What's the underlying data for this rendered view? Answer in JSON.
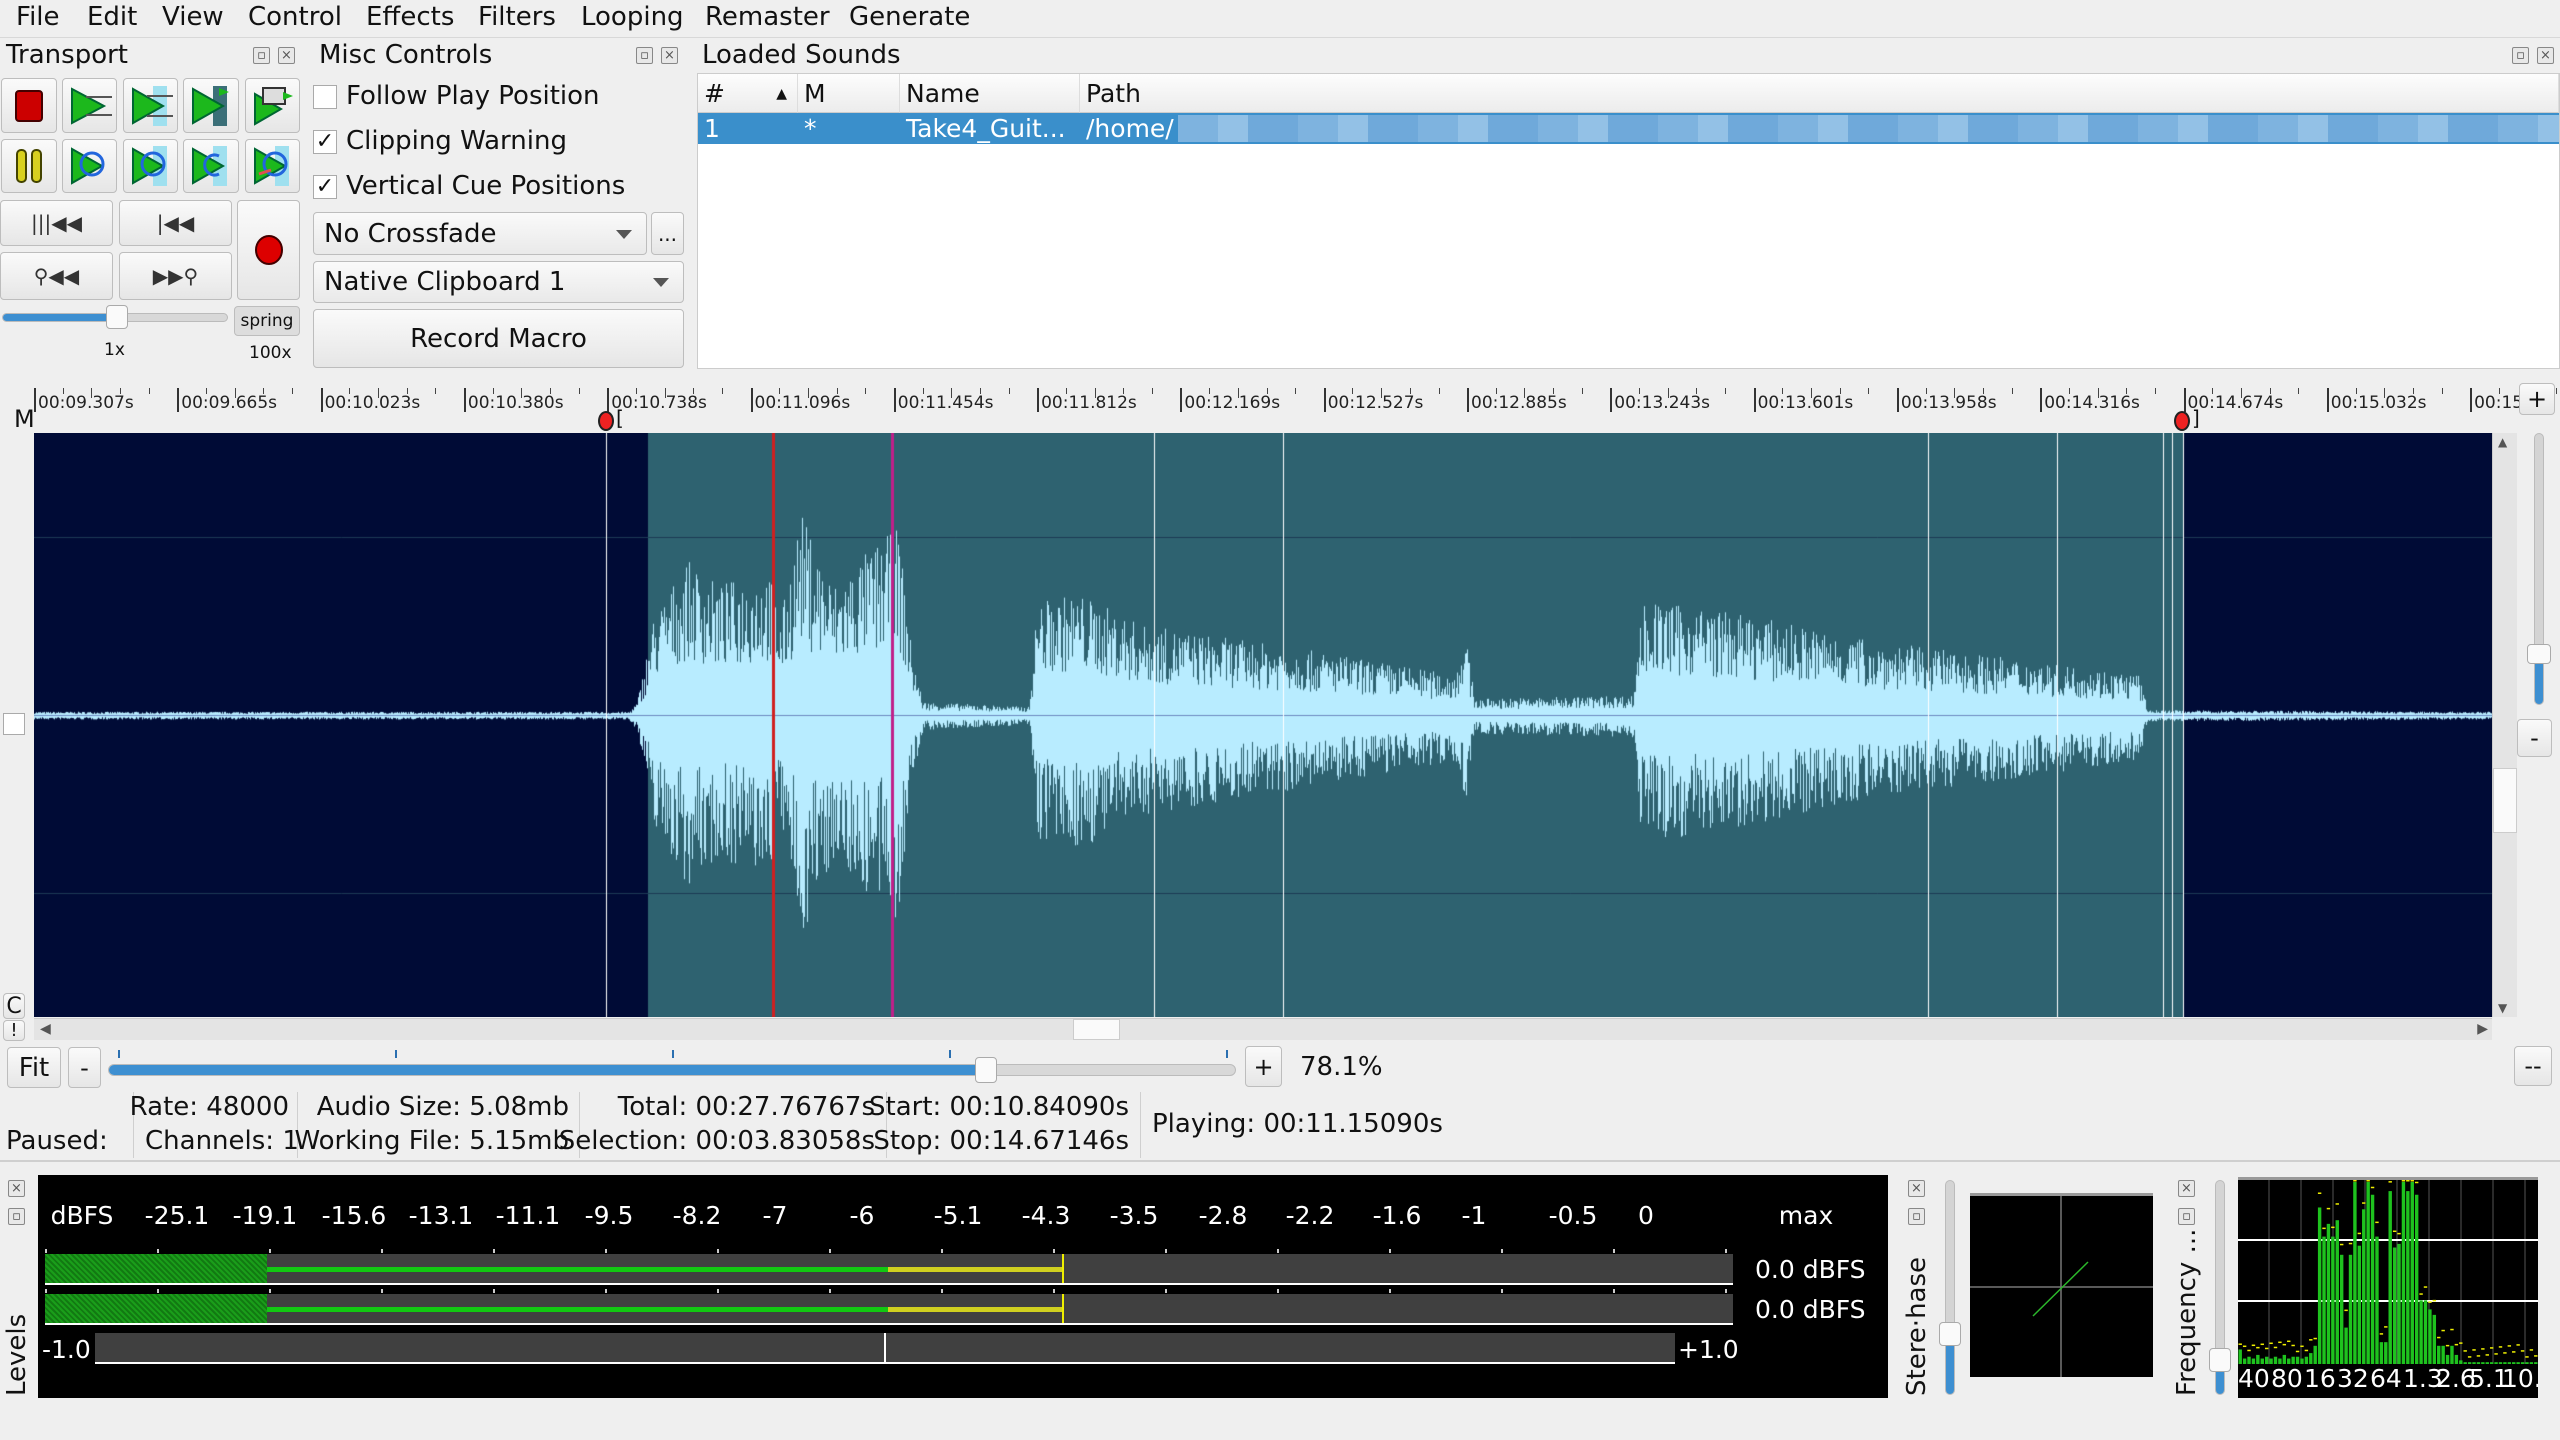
{
  "menu": [
    "File",
    "Edit",
    "View",
    "Control",
    "Effects",
    "Filters",
    "Looping",
    "Remaster",
    "Generate"
  ],
  "transport": {
    "title": "Transport",
    "spring_label": "spring",
    "speed_min_label": "1x",
    "speed_max_label": "100x",
    "speed_value": 0.5
  },
  "misc": {
    "title": "Misc Controls",
    "follow_play_position": {
      "label": "Follow Play Position",
      "checked": false
    },
    "clipping_warning": {
      "label": "Clipping Warning",
      "checked": true
    },
    "vertical_cue_positions": {
      "label": "Vertical Cue Positions",
      "checked": true
    },
    "crossfade": "No Crossfade",
    "more_label": "...",
    "clipboard": "Native Clipboard 1",
    "record_macro": "Record Macro"
  },
  "loaded_sounds": {
    "title": "Loaded Sounds",
    "columns": [
      "#",
      "M",
      "Name",
      "Path"
    ],
    "rows": [
      {
        "num": "1",
        "modified": "*",
        "name": "Take4_Guit...",
        "path": "/home/"
      }
    ]
  },
  "ruler": {
    "labels": [
      "00:09.307s",
      "00:09.665s",
      "00:10.023s",
      "00:10.380s",
      "00:10.738s",
      "00:11.096s",
      "00:11.454s",
      "00:11.812s",
      "00:12.169s",
      "00:12.527s",
      "00:12.885s",
      "00:13.243s",
      "00:13.601s",
      "00:13.958s",
      "00:14.316s",
      "00:14.674s",
      "00:15.032s",
      "00:15"
    ],
    "marker_label": "M",
    "start_bracket": "[",
    "stop_bracket": "]"
  },
  "waveform": {
    "colors": {
      "background": "#000b36",
      "selection": "#2e6270",
      "wave": "#b8ecff",
      "play_position": "#d02020",
      "cursor": "#c0208a"
    }
  },
  "side_buttons": {
    "c": "C",
    "bang": "!",
    "plus": "+",
    "minus": "-",
    "dashes": "--"
  },
  "zoom": {
    "fit": "Fit",
    "minus": "-",
    "plus": "+",
    "percent": "78.1%",
    "slider_value": 0.781
  },
  "status": {
    "paused": "Paused:",
    "rate": "Rate: 48000",
    "channels": "Channels: 1",
    "audio_size": "Audio Size:  5.08mb",
    "working_file": "Working File:  5.15mb",
    "total": "Total: 00:27.76767s",
    "selection": "Selection: 00:03.83058s",
    "start": "Start: 00:10.84090s",
    "stop": "Stop: 00:14.67146s",
    "playing": "Playing: 00:11.15090s"
  },
  "levels": {
    "title": "Levels",
    "scale": [
      "dBFS",
      "-25.1",
      "-19.1",
      "-15.6",
      "-13.1",
      "-11.1",
      "-9.5",
      "-8.2",
      "-7",
      "-6",
      "-5.1",
      "-4.3",
      "-3.5",
      "-2.8",
      "-2.2",
      "-1.6",
      "-1",
      "-0.5",
      "0"
    ],
    "max_label": "max",
    "channel_max": [
      "0.0 dBFS",
      "0.0 dBFS"
    ],
    "pan_min": "-1.0",
    "pan_max": "+1.0"
  },
  "phase": {
    "title": "Stereo Phase",
    "visible_title": "Stere·hase"
  },
  "frequency": {
    "title": "Frequency ...",
    "labels": [
      "40",
      "80",
      "16",
      "32",
      "64",
      "1.3",
      "2.6",
      "5.1",
      "10."
    ],
    "levels": [
      0.08,
      0.03,
      0.04,
      0.03,
      0.05,
      0.03,
      0.04,
      0.03,
      0.04,
      0.03,
      0.05,
      0.03,
      0.04,
      0.04,
      0.03,
      0.04,
      0.06,
      0.1,
      0.86,
      0.7,
      0.77,
      0.7,
      0.79,
      0.6,
      0.2,
      0.6,
      1.0,
      0.65,
      0.85,
      1.0,
      0.93,
      0.7,
      0.12,
      0.12,
      0.95,
      0.64,
      0.66,
      1.0,
      0.95,
      1.0,
      0.93,
      0.35,
      0.35,
      0.3,
      0.27,
      0.1,
      0.1,
      0.05,
      0.1,
      0.05,
      0.02,
      0.01,
      0.01,
      0.01,
      0.01,
      0.01,
      0.01,
      0.01,
      0.01,
      0.01,
      0.01,
      0.01,
      0.01,
      0.01,
      0.01,
      0.01,
      0.01,
      0.01
    ]
  }
}
